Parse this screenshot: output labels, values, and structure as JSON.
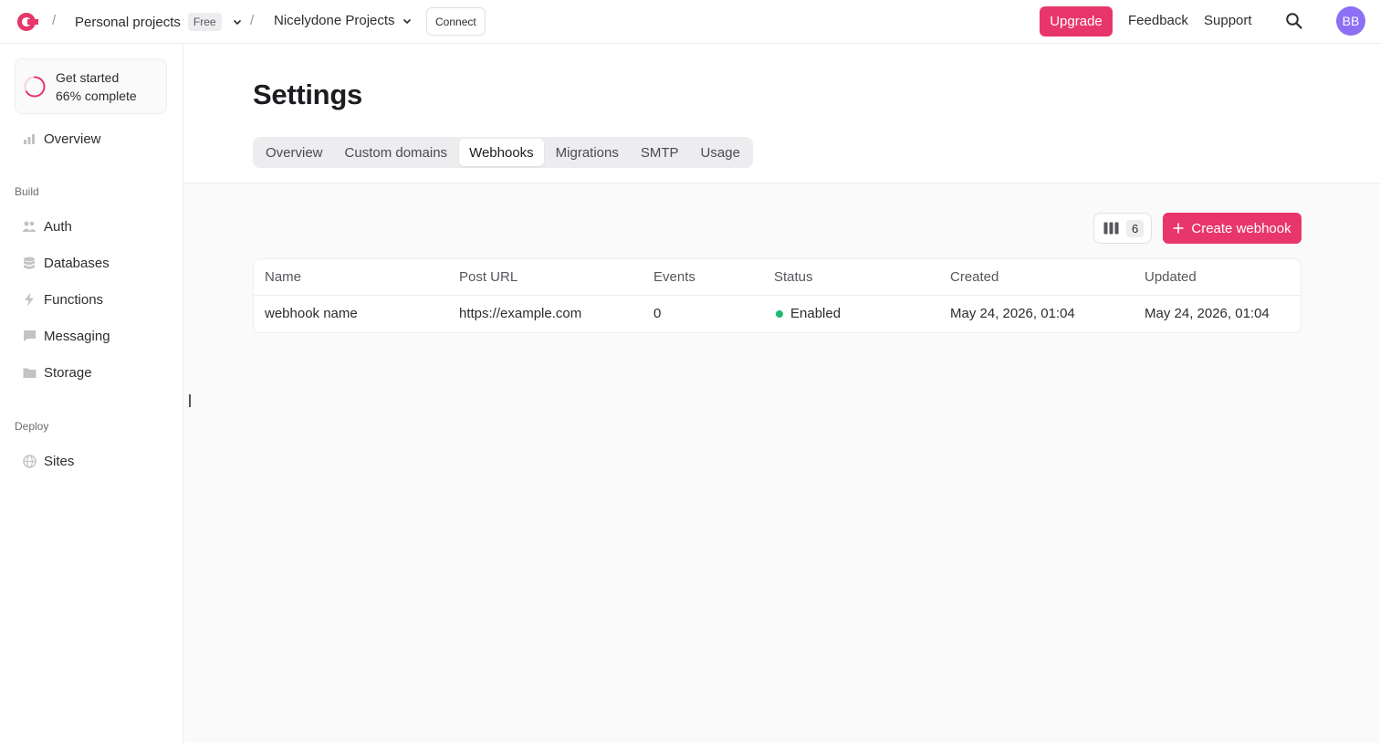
{
  "header": {
    "org_name": "Personal projects",
    "plan_badge": "Free",
    "project_name": "Nicelydone Projects",
    "connect_label": "Connect",
    "upgrade_label": "Upgrade",
    "feedback_label": "Feedback",
    "support_label": "Support",
    "avatar_initials": "BB",
    "separator": "/"
  },
  "sidebar": {
    "get_started": {
      "title": "Get started",
      "progress_text": "66% complete",
      "progress": 0.66
    },
    "overview_label": "Overview",
    "sections": [
      {
        "label": "Build",
        "items": [
          {
            "label": "Auth",
            "icon": "users-icon"
          },
          {
            "label": "Databases",
            "icon": "database-icon"
          },
          {
            "label": "Functions",
            "icon": "lightning-icon"
          },
          {
            "label": "Messaging",
            "icon": "chat-bubble-icon"
          },
          {
            "label": "Storage",
            "icon": "folder-icon"
          }
        ]
      },
      {
        "label": "Deploy",
        "items": [
          {
            "label": "Sites",
            "icon": "globe-icon"
          }
        ]
      }
    ]
  },
  "page": {
    "title": "Settings",
    "tabs": [
      {
        "label": "Overview",
        "active": false
      },
      {
        "label": "Custom domains",
        "active": false
      },
      {
        "label": "Webhooks",
        "active": true
      },
      {
        "label": "Migrations",
        "active": false
      },
      {
        "label": "SMTP",
        "active": false
      },
      {
        "label": "Usage",
        "active": false
      }
    ]
  },
  "toolbar": {
    "columns_count": "6",
    "create_label": "Create webhook"
  },
  "table": {
    "columns": [
      "Name",
      "Post URL",
      "Events",
      "Status",
      "Created",
      "Updated"
    ],
    "rows": [
      {
        "name": "webhook name",
        "post_url": "https://example.com",
        "events": "0",
        "status": "Enabled",
        "created": "May 24, 2026, 01:04",
        "updated": "May 24, 2026, 01:04"
      }
    ]
  },
  "colors": {
    "accent": "#e8366a",
    "status_enabled": "#1fba71",
    "avatar": "#8b6ff5"
  }
}
